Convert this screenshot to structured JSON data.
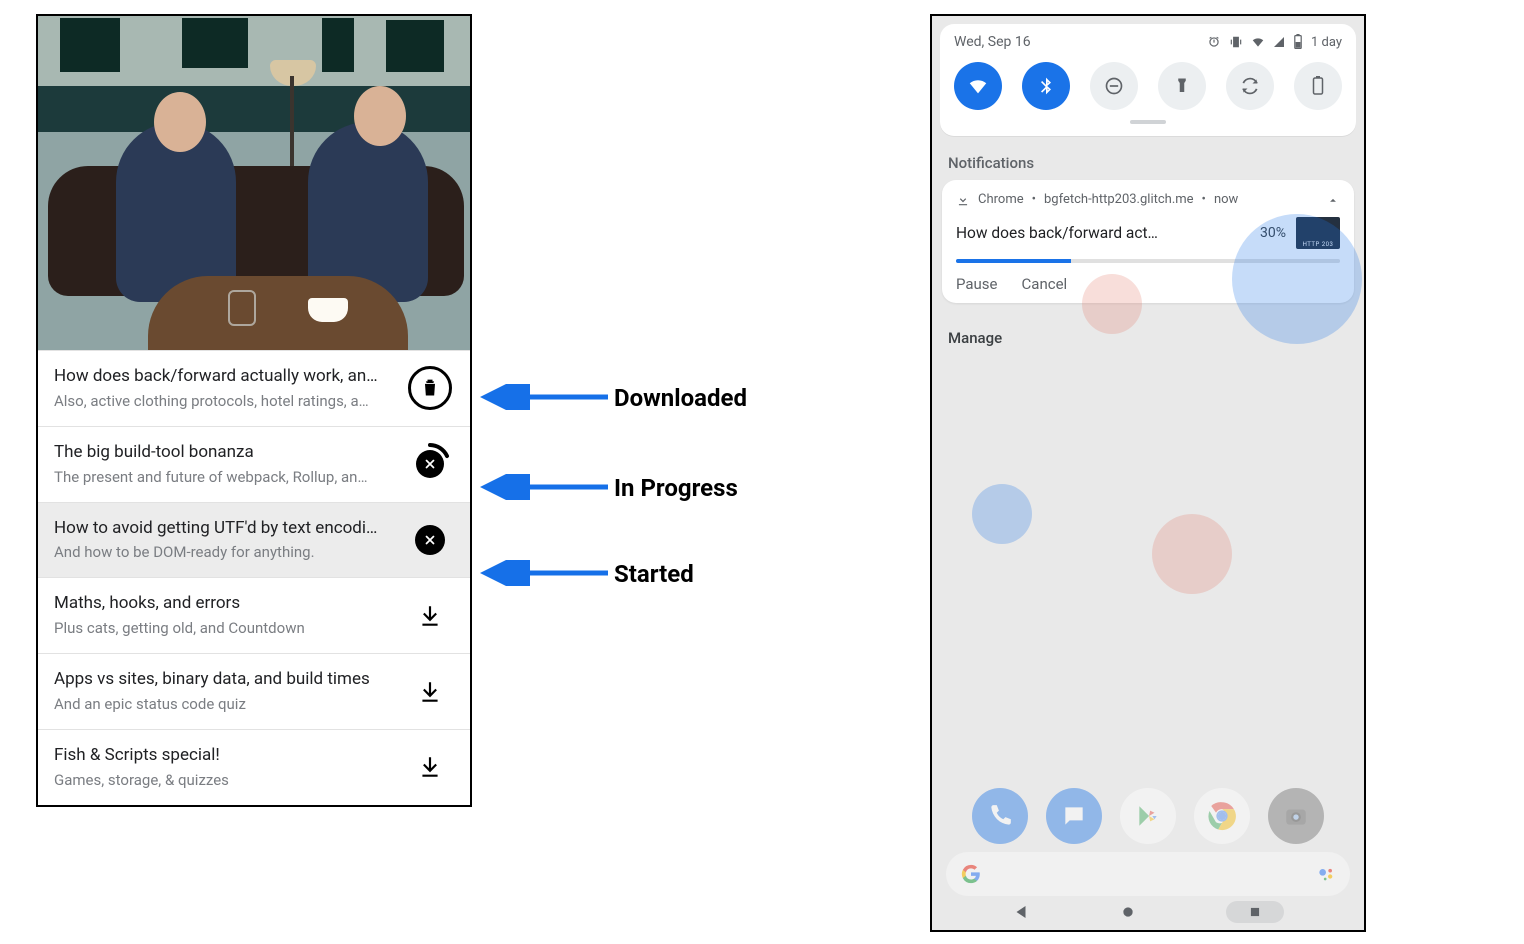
{
  "episodes": [
    {
      "title": "How does back/forward actually work, an…",
      "subtitle": "Also, active clothing protocols, hotel ratings, a…",
      "state": "downloaded",
      "selected": false
    },
    {
      "title": "The big build-tool bonanza",
      "subtitle": "The present and future of webpack, Rollup, an…",
      "state": "inprogress",
      "selected": false
    },
    {
      "title": "How to avoid getting UTF'd by text encodi…",
      "subtitle": "And how to be DOM-ready for anything.",
      "state": "started",
      "selected": true
    },
    {
      "title": "Maths, hooks, and errors",
      "subtitle": "Plus cats, getting old, and Countdown",
      "state": "idle",
      "selected": false
    },
    {
      "title": "Apps vs sites, binary data, and build times",
      "subtitle": "And an epic status code quiz",
      "state": "idle",
      "selected": false
    },
    {
      "title": "Fish & Scripts special!",
      "subtitle": "Games, storage, & quizzes",
      "state": "idle",
      "selected": false
    }
  ],
  "annotations": {
    "downloaded": "Downloaded",
    "inprogress": "In Progress",
    "started": "Started"
  },
  "phone": {
    "status_date": "Wed, Sep 16",
    "status_battery_label": "1 day",
    "notif_section_label": "Notifications",
    "notif": {
      "app": "Chrome",
      "origin": "bgfetch-http203.glitch.me",
      "time": "now",
      "title": "How does back/forward act…",
      "percent_label": "30%",
      "percent_value": 30,
      "thumb_label": "HTTP 203",
      "action_pause": "Pause",
      "action_cancel": "Cancel"
    },
    "manage_label": "Manage"
  }
}
